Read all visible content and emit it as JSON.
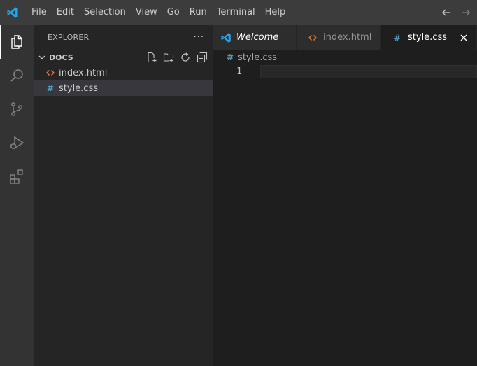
{
  "menu": [
    "File",
    "Edit",
    "Selection",
    "View",
    "Go",
    "Run",
    "Terminal",
    "Help"
  ],
  "explorer": {
    "title": "EXPLORER",
    "more": "···",
    "section": "DOCS",
    "files": [
      {
        "name": "index.html",
        "icon": "html-file-icon",
        "icon_glyph": "<>",
        "selected": false
      },
      {
        "name": "style.css",
        "icon": "css-file-icon",
        "icon_glyph": "#",
        "selected": true
      }
    ]
  },
  "tabs": [
    {
      "label": "Welcome",
      "icon": "vscode-logo-icon",
      "active": false
    },
    {
      "label": "index.html",
      "icon": "html-file-icon",
      "icon_glyph": "<>",
      "active": false
    },
    {
      "label": "style.css",
      "icon": "css-file-icon",
      "icon_glyph": "#",
      "active": true
    }
  ],
  "breadcrumb": {
    "icon_glyph": "#",
    "label": "style.css"
  },
  "editor": {
    "line_numbers": [
      "1"
    ]
  },
  "colors": {
    "accent_blue": "#23a9f2",
    "html_icon": "#e37933",
    "css_icon": "#519aba"
  }
}
